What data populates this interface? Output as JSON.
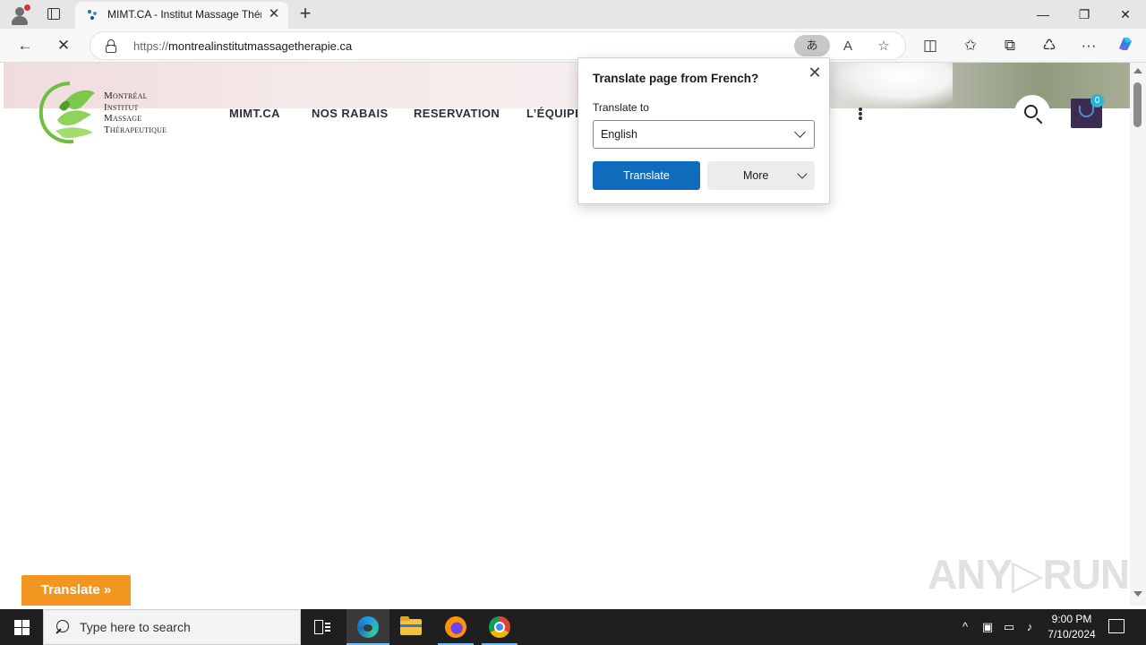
{
  "browser": {
    "tab": {
      "title": "MIMT.CA - Institut Massage Thérapeutique",
      "close": "✕"
    },
    "new_tab": "+",
    "window_controls": {
      "minimize": "—",
      "restore": "❐",
      "close": "✕"
    },
    "toolbar": {
      "back": "←",
      "stop": "✕",
      "url_scheme": "https://",
      "url_host": "montrealinstitutmassagetherapie.ca",
      "translate_glyph": "あ",
      "read_aloud": "A",
      "favorite": "☆",
      "split": "◫",
      "favorites": "✩",
      "collections": "⧉",
      "extensions": "♺",
      "menu": "···"
    }
  },
  "site": {
    "logo_lines": [
      "Montréal",
      "Institut",
      "Massage",
      "Thérapeutique"
    ],
    "nav": [
      "MIMT.CA",
      "NOS RABAIS",
      "RESERVATION",
      "L’ÉQUIPE"
    ],
    "cart_count": "0",
    "gtranslate_label": "Translate »",
    "watermark": "ANY▷RUN"
  },
  "translate_popup": {
    "title": "Translate page from French?",
    "label": "Translate to",
    "selected_language": "English",
    "translate_button": "Translate",
    "more_button": "More",
    "close": "✕"
  },
  "taskbar": {
    "search_placeholder": "Type here to search",
    "time": "9:00 PM",
    "date": "7/10/2024"
  },
  "colors": {
    "accent_blue": "#0f6cbd",
    "gtranslate_orange": "#f39621",
    "cart_purple": "#3b2d52",
    "badge_cyan": "#29b6d6",
    "logo_green": "#6cbf3f"
  }
}
